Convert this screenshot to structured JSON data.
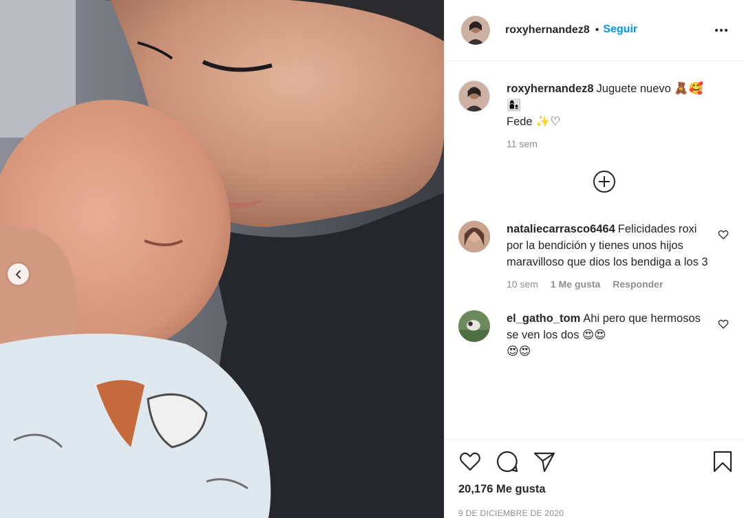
{
  "post": {
    "author": "roxyhernandez8",
    "separator": "•",
    "follow_label": "Seguir",
    "caption_line1": "Juguete nuevo",
    "caption_emoji1": "🧸🥰",
    "caption_emoji2": "👩‍👦",
    "caption_line2": "Fede",
    "caption_emoji3": "✨♡",
    "caption_time": "11 sem",
    "likes": "20,176 Me gusta",
    "date": "9 DE DICIEMBRE DE 2020"
  },
  "comments": [
    {
      "user": "nataliecarrasco6464",
      "text": "Felicidades roxi por la bendición y tienes unos hijos maravilloso que dios los bendiga a los 3",
      "time": "10 sem",
      "likes": "1 Me gusta",
      "reply": "Responder"
    },
    {
      "user": "el_gatho_tom",
      "text": "Ahi pero que hermosos se ven los dos 😍😍",
      "text2": "😍😍",
      "time": "",
      "likes": "",
      "reply": ""
    }
  ],
  "colors": {
    "link": "#0095f6",
    "muted": "#8e8e8e",
    "text": "#262626",
    "border": "#efefef"
  },
  "icons": [
    "chevron-left-icon",
    "more-icon",
    "add-circle-icon",
    "heart-icon",
    "comment-icon",
    "share-icon",
    "bookmark-icon"
  ]
}
